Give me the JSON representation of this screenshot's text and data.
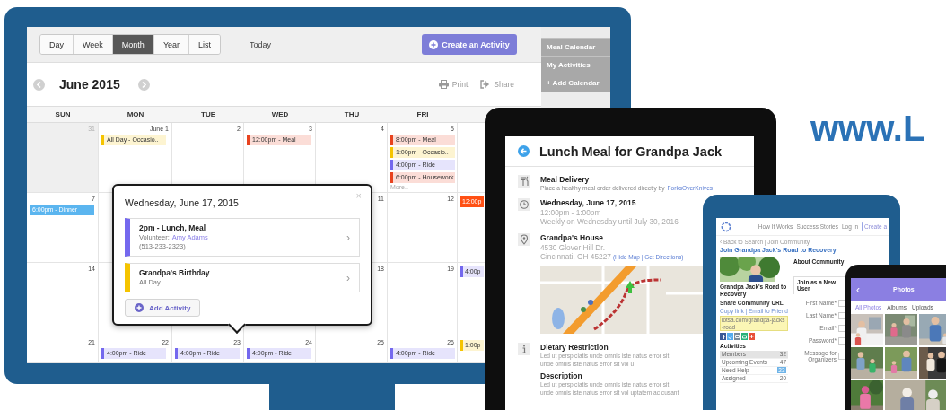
{
  "monitor": {
    "views": [
      {
        "label": "Day",
        "selected": false
      },
      {
        "label": "Week",
        "selected": false
      },
      {
        "label": "Month",
        "selected": true
      },
      {
        "label": "Year",
        "selected": false
      },
      {
        "label": "List",
        "selected": false
      }
    ],
    "today": "Today",
    "create": "Create an Activity",
    "sidebar": [
      "Meal Calendar",
      "My Activities",
      "+ Add Calendar"
    ],
    "title": "June 2015",
    "print": "Print",
    "share": "Share",
    "weekdays": [
      "SUN",
      "MON",
      "TUE",
      "WED",
      "THU",
      "FRI"
    ],
    "weeks": [
      {
        "sun": {
          "date": "31",
          "muted": true
        },
        "mon": {
          "date": "June 1",
          "muted": false,
          "events": [
            {
              "label": "All Day - Occasio..",
              "kind": "tinted",
              "color": "#f5c400"
            }
          ]
        },
        "tue": {
          "date": "2",
          "muted": false
        },
        "wed": {
          "date": "3",
          "muted": false,
          "events": [
            {
              "label": "12:00pm - Meal",
              "kind": "tinted",
              "color": "#e8431f"
            }
          ]
        },
        "thu": {
          "date": "4",
          "muted": false
        },
        "fri": {
          "date": "5",
          "muted": false,
          "events": [
            {
              "label": "8:00pm - Meal",
              "kind": "tinted",
              "color": "#e8431f"
            },
            {
              "label": "1:00pm - Occasio..",
              "kind": "tinted",
              "color": "#f5c400"
            },
            {
              "label": "4:00pm - Ride",
              "kind": "tinted",
              "color": "#7468ee"
            },
            {
              "label": "6:00pm - Housework",
              "kind": "tinted",
              "color": "#e8431f"
            }
          ],
          "more": "More.."
        }
      },
      {
        "sun": {
          "date": "7",
          "muted": false,
          "events": [
            {
              "label": "6:00pm - Dinner",
              "kind": "solid",
              "color": "#5bb5ef"
            }
          ]
        },
        "thu": {
          "date": "11",
          "muted": false
        },
        "fri": {
          "date": "12",
          "muted": false
        },
        "sat": {
          "events": [
            {
              "label": "12:00p",
              "kind": "solid",
              "color": "#ff5014"
            }
          ]
        }
      },
      {
        "sun": {
          "date": "14",
          "muted": false
        },
        "thu": {
          "date": "18",
          "muted": false
        },
        "fri": {
          "date": "19",
          "muted": false
        },
        "sat": {
          "events": [
            {
              "label": "4:00p",
              "kind": "tinted",
              "color": "#7468ee"
            }
          ]
        }
      },
      {
        "sun": {
          "date": "21",
          "muted": false
        },
        "mon": {
          "date": "22",
          "muted": false,
          "events": [
            {
              "label": "4:00pm - Ride",
              "kind": "tinted",
              "color": "#7468ee"
            }
          ]
        },
        "tue": {
          "date": "23",
          "muted": false,
          "events": [
            {
              "label": "4:00pm - Ride",
              "kind": "tinted",
              "color": "#7468ee"
            }
          ]
        },
        "wed": {
          "date": "24",
          "muted": false,
          "events": [
            {
              "label": "4:00pm - Ride",
              "kind": "tinted",
              "color": "#7468ee"
            }
          ]
        },
        "thu": {
          "date": "25",
          "muted": false
        },
        "fri": {
          "date": "26",
          "muted": false,
          "events": [
            {
              "label": "4:00pm - Ride",
              "kind": "tinted",
              "color": "#7468ee"
            }
          ]
        },
        "sat": {
          "events": [
            {
              "label": "1:00p",
              "kind": "tinted",
              "color": "#f5c400"
            }
          ]
        }
      }
    ],
    "popover": {
      "title": "Wednesday, June 17, 2015",
      "close": "×",
      "items": [
        {
          "kind": "volunteer",
          "title": "2pm - Lunch, Meal",
          "color": "#7468ee",
          "volunteer_label": "Volunteer:",
          "volunteer": "Amy Adams",
          "phone": "(513-233-2323)",
          "chevron": "›"
        },
        {
          "kind": "plain",
          "title": "Grandpa's Birthday",
          "color": "#f5c400",
          "subtitle": "All Day",
          "chevron": "›"
        }
      ],
      "add": "Add Activity"
    }
  },
  "event_tablet": {
    "title": "Lunch Meal for Grandpa Jack",
    "sections": [
      {
        "kind": "meal",
        "heading": "Meal Delivery",
        "text": "Place a healthy meal order delivered directly by",
        "link": "ForksOverKnives"
      },
      {
        "kind": "time",
        "heading": "Wednesday, June 17, 2015",
        "lines": [
          "12:00pm - 1:00pm",
          "Weekly on Wednesday until July 30, 2016"
        ]
      },
      {
        "kind": "place",
        "heading": "Grandpa's House",
        "lines": [
          "4530 Glover Hill Dr.",
          "Cincinnati, OH 45227"
        ],
        "links": "(Hide Map | Get Directions)",
        "map": {
          "kind": "picture"
        }
      },
      {
        "kind": "note",
        "heading": "Dietary Restriction",
        "paragraph": [
          "Led ut perspiciatis unde omnis iste natus error sit",
          "unde omnis iste natus error sit vol u"
        ]
      },
      {
        "kind": "text",
        "heading": "Description",
        "paragraph": [
          "Led ut perspiciatis unde omnis iste natus error sit",
          "unde omnis iste natus error sit vol uptatem ac cusant"
        ]
      }
    ]
  },
  "community_tablet": {
    "nav": [
      "How It Works",
      "Success Stories",
      "Log In"
    ],
    "nav_button": "Create a",
    "breadcrumb": "‹ Back to Search | Join Community",
    "title": "Join Grandpa Jack's Road to Recovery",
    "photo": {
      "kind": "picture"
    },
    "name": "Grandpa Jack's Road to Recovery",
    "share_heading": "Share Community URL",
    "share_links": "Copy link | Email to Friend",
    "url": "lotsa.com/grandpa-jacks-road",
    "activities_heading": "Activities",
    "stats": [
      {
        "label": "Members",
        "value": "32",
        "selected": true,
        "kind": "plain"
      },
      {
        "label": "Upcoming Events",
        "value": "47",
        "selected": false,
        "kind": "plain"
      },
      {
        "label": "Need Help",
        "value": "23",
        "selected": false,
        "kind": "badge"
      },
      {
        "label": "Assigned",
        "value": "20",
        "selected": false,
        "kind": "plain"
      }
    ],
    "about_heading": "About Community",
    "join_tab": "Join as a New User",
    "fields": [
      "First Name*",
      "Last Name*",
      "Email*",
      "Password*",
      "Message for Organizers"
    ]
  },
  "phone": {
    "back": "‹",
    "title": "Photos",
    "tabs": [
      {
        "label": "All Photos",
        "selected": true
      },
      {
        "label": "Albums",
        "selected": false
      },
      {
        "label": "Uploads",
        "selected": false
      }
    ],
    "photos": [
      {
        "kind": "picture"
      },
      {
        "kind": "picture"
      },
      {
        "kind": "picture"
      },
      {
        "kind": "picture"
      },
      {
        "kind": "picture"
      },
      {
        "kind": "picture"
      },
      {
        "kind": "picture"
      },
      {
        "kind": "picture"
      }
    ]
  },
  "promo": {
    "website": "www.L"
  }
}
